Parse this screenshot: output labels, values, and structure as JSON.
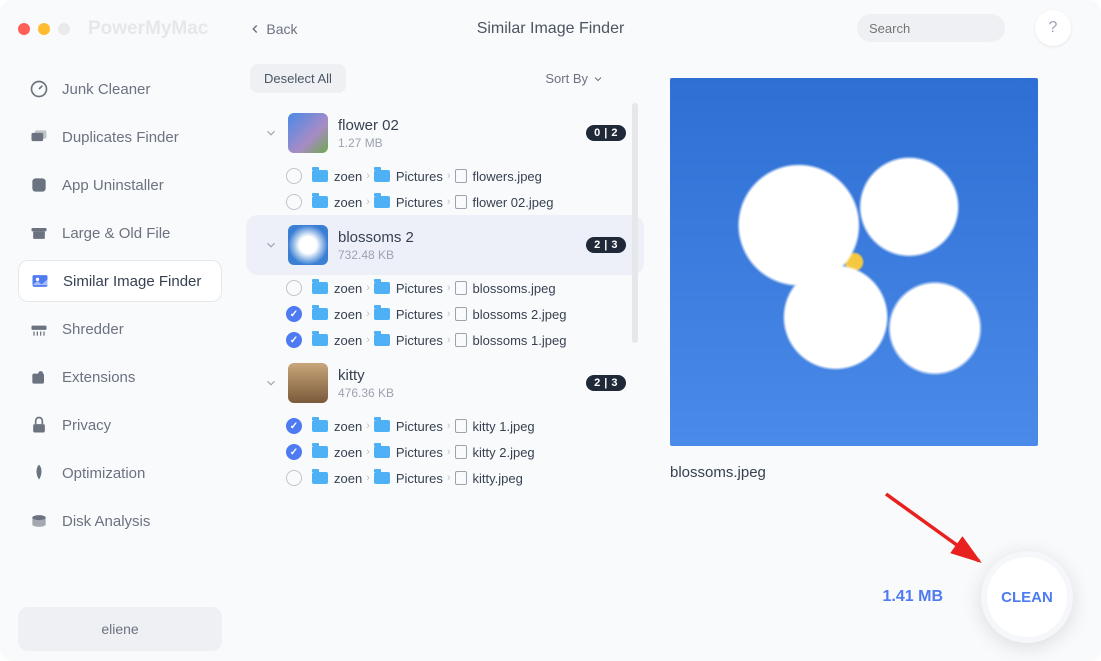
{
  "brand": "PowerMyMac",
  "back_label": "Back",
  "page_title": "Similar Image Finder",
  "search_placeholder": "Search",
  "help_label": "?",
  "sidebar": [
    {
      "id": "junk-cleaner",
      "label": "Junk Cleaner"
    },
    {
      "id": "duplicates-finder",
      "label": "Duplicates Finder"
    },
    {
      "id": "app-uninstaller",
      "label": "App Uninstaller"
    },
    {
      "id": "large-old-file",
      "label": "Large & Old File"
    },
    {
      "id": "similar-image-finder",
      "label": "Similar Image Finder"
    },
    {
      "id": "shredder",
      "label": "Shredder"
    },
    {
      "id": "extensions",
      "label": "Extensions"
    },
    {
      "id": "privacy",
      "label": "Privacy"
    },
    {
      "id": "optimization",
      "label": "Optimization"
    },
    {
      "id": "disk-analysis",
      "label": "Disk Analysis"
    }
  ],
  "user": "eliene",
  "deselect_label": "Deselect All",
  "sort_label": "Sort By",
  "groups": [
    {
      "name": "flower 02",
      "size": "1.27 MB",
      "badge": "0 | 2",
      "thumb": "flower",
      "selected": false,
      "files": [
        {
          "checked": false,
          "path": [
            "zoen",
            "Pictures"
          ],
          "file": "flowers.jpeg"
        },
        {
          "checked": false,
          "path": [
            "zoen",
            "Pictures"
          ],
          "file": "flower 02.jpeg"
        }
      ]
    },
    {
      "name": "blossoms 2",
      "size": "732.48 KB",
      "badge": "2 | 3",
      "thumb": "blossoms",
      "selected": true,
      "files": [
        {
          "checked": false,
          "path": [
            "zoen",
            "Pictures"
          ],
          "file": "blossoms.jpeg"
        },
        {
          "checked": true,
          "path": [
            "zoen",
            "Pictures"
          ],
          "file": "blossoms 2.jpeg"
        },
        {
          "checked": true,
          "path": [
            "zoen",
            "Pictures"
          ],
          "file": "blossoms 1.jpeg"
        }
      ]
    },
    {
      "name": "kitty",
      "size": "476.36 KB",
      "badge": "2 | 3",
      "thumb": "kitty",
      "selected": false,
      "files": [
        {
          "checked": true,
          "path": [
            "zoen",
            "Pictures"
          ],
          "file": "kitty 1.jpeg"
        },
        {
          "checked": true,
          "path": [
            "zoen",
            "Pictures"
          ],
          "file": "kitty 2.jpeg"
        },
        {
          "checked": false,
          "path": [
            "zoen",
            "Pictures"
          ],
          "file": "kitty.jpeg"
        }
      ]
    }
  ],
  "preview_file": "blossoms.jpeg",
  "total_size": "1.41 MB",
  "clean_label": "CLEAN"
}
